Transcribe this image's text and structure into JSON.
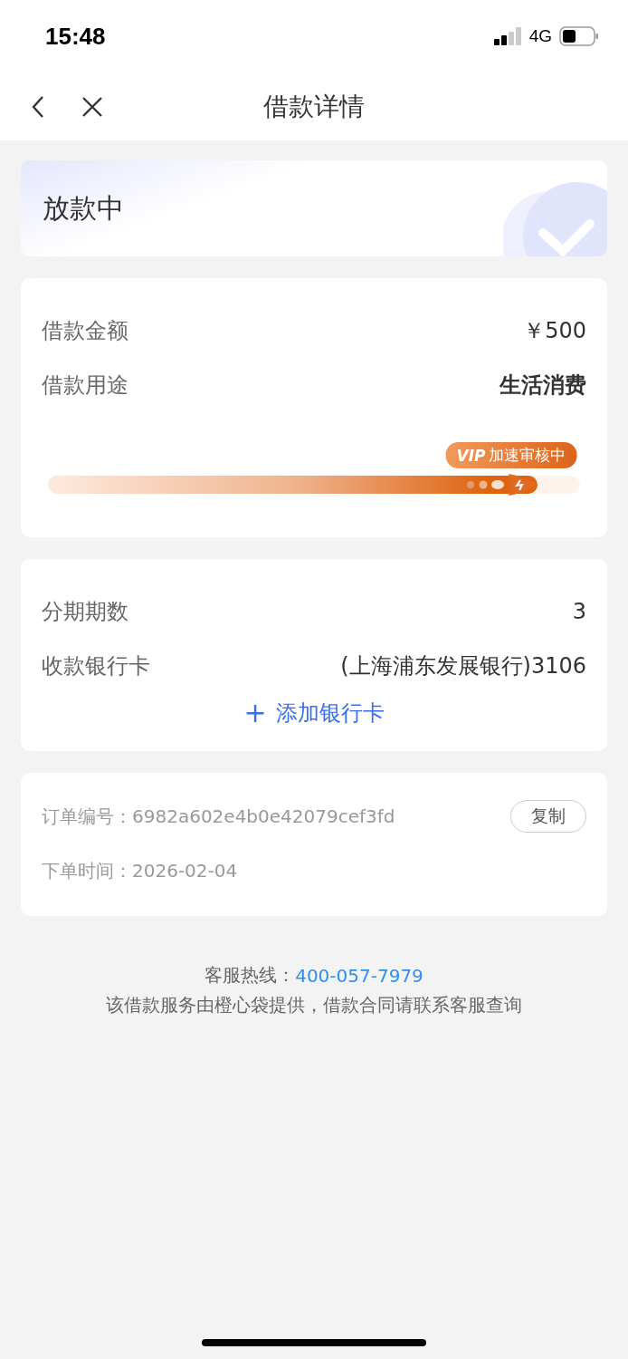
{
  "status_bar": {
    "time": "15:48",
    "network": "4G"
  },
  "nav": {
    "title": "借款详情"
  },
  "status_card": {
    "status": "放款中"
  },
  "loan_card": {
    "rows": [
      {
        "label": "借款金额",
        "value": "￥500",
        "emphasis": false
      },
      {
        "label": "借款用途",
        "value": "生活消费",
        "emphasis": true
      }
    ],
    "progress": {
      "badge_vip": "VIP",
      "badge_text": "加速审核中",
      "level": 0.92
    }
  },
  "bank_card": {
    "rows": [
      {
        "label": "分期期数",
        "value": "3"
      },
      {
        "label": "收款银行卡",
        "value": "(上海浦东发展银行)3106"
      }
    ],
    "add_button": {
      "icon": "+",
      "label": "添加银行卡"
    }
  },
  "order_card": {
    "rows": [
      {
        "label": "订单编号：",
        "value": "6982a602e4b0e42079cef3fd",
        "copy_button": "复制"
      },
      {
        "label": "下单时间：",
        "value": "2026-02-04"
      }
    ]
  },
  "footer": {
    "hotline_label": "客服热线：",
    "hotline": "400-057-7979",
    "note": "该借款服务由橙心袋提供，借款合同请联系客服查询"
  }
}
